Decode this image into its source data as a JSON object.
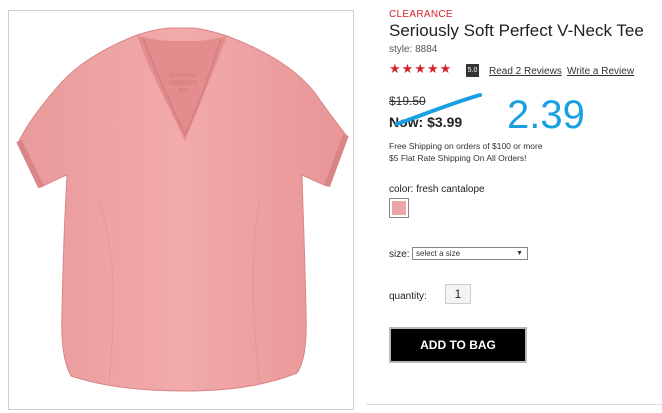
{
  "product": {
    "tag": "CLEARANCE",
    "title": "Seriously Soft Perfect V-Neck Tee",
    "style": "style: 8884",
    "image_alt": "pink v-neck t-shirt",
    "brand_print": [
      "SERIOUSLY",
      "PERFECT",
      "TEE"
    ]
  },
  "rating": {
    "stars": 5,
    "score": "5.0",
    "reviews_link": "Read 2 Reviews",
    "write_link": "Write a Review",
    "star_color": "#d2232a"
  },
  "pricing": {
    "old_price": "$19.50",
    "now_price": "Now: $3.99",
    "annotation": "2.39",
    "annotation_color": "#1aa0e0"
  },
  "shipping": [
    "Free Shipping on orders of $100 or more",
    "$5 Flat Rate Shipping On All Orders!"
  ],
  "color": {
    "label": "color: fresh cantalope",
    "swatch_color": "#eea5a8"
  },
  "size": {
    "label": "size:",
    "selected": "select a size"
  },
  "quantity": {
    "label": "quantity:",
    "value": "1"
  },
  "add_to_bag": "ADD TO BAG"
}
